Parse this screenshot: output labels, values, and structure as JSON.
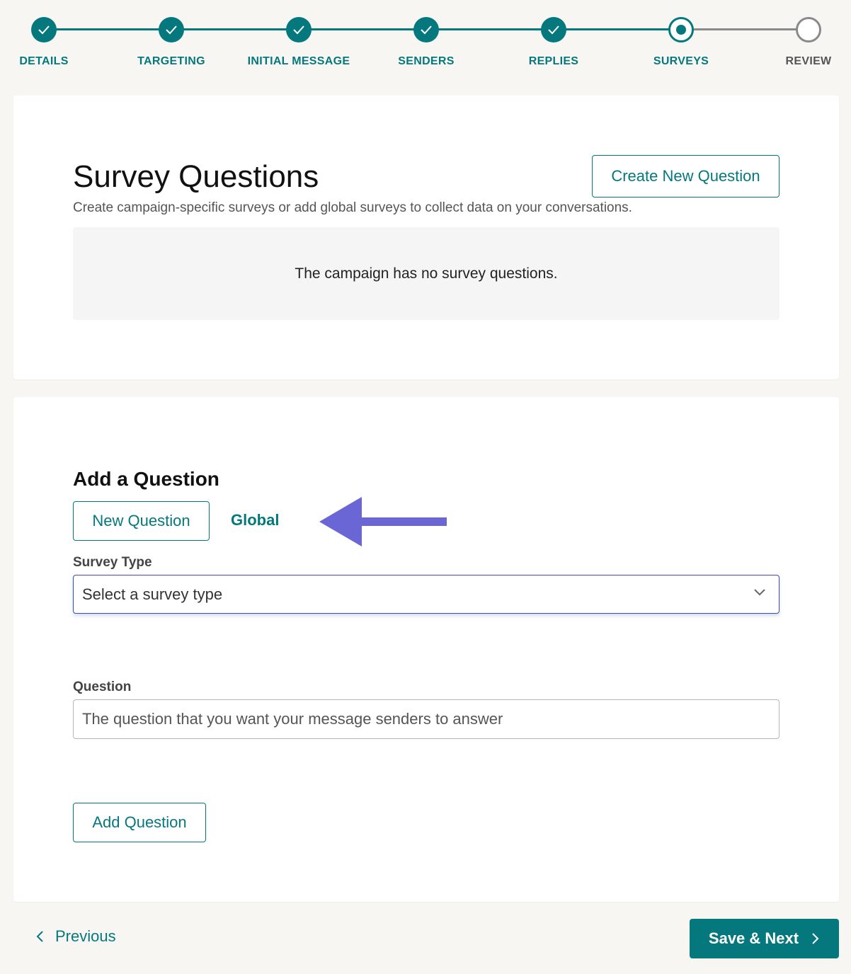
{
  "stepper": {
    "steps": [
      {
        "label": "DETAILS",
        "state": "done"
      },
      {
        "label": "TARGETING",
        "state": "done"
      },
      {
        "label": "INITIAL MESSAGE",
        "state": "done"
      },
      {
        "label": "SENDERS",
        "state": "done"
      },
      {
        "label": "REPLIES",
        "state": "done"
      },
      {
        "label": "SURVEYS",
        "state": "current"
      },
      {
        "label": "REVIEW",
        "state": "todo"
      }
    ]
  },
  "survey_questions": {
    "title": "Survey Questions",
    "subtitle": "Create campaign-specific surveys or add global surveys to collect data on your conversations.",
    "create_button": "Create New Question",
    "empty_message": "The campaign has no survey questions."
  },
  "add_question": {
    "title": "Add a Question",
    "tab_new": "New Question",
    "tab_global": "Global",
    "survey_type_label": "Survey Type",
    "survey_type_value": "Select a survey type",
    "question_label": "Question",
    "question_placeholder": "The question that you want your message senders to answer",
    "add_button": "Add Question"
  },
  "footer": {
    "previous_label": "Previous",
    "save_next_label": "Save & Next"
  },
  "colors": {
    "primary": "#05787e",
    "pending": "#8a8a8a",
    "annotation_arrow": "#6b66d6",
    "select_border": "#3b4fa8"
  },
  "icons": {
    "done_step": "check-icon",
    "current_step": "radio-dot-icon",
    "select_caret": "chevron-down-icon",
    "previous": "chevron-left-icon",
    "next": "chevron-right-icon",
    "annotation": "arrow-left-icon"
  }
}
